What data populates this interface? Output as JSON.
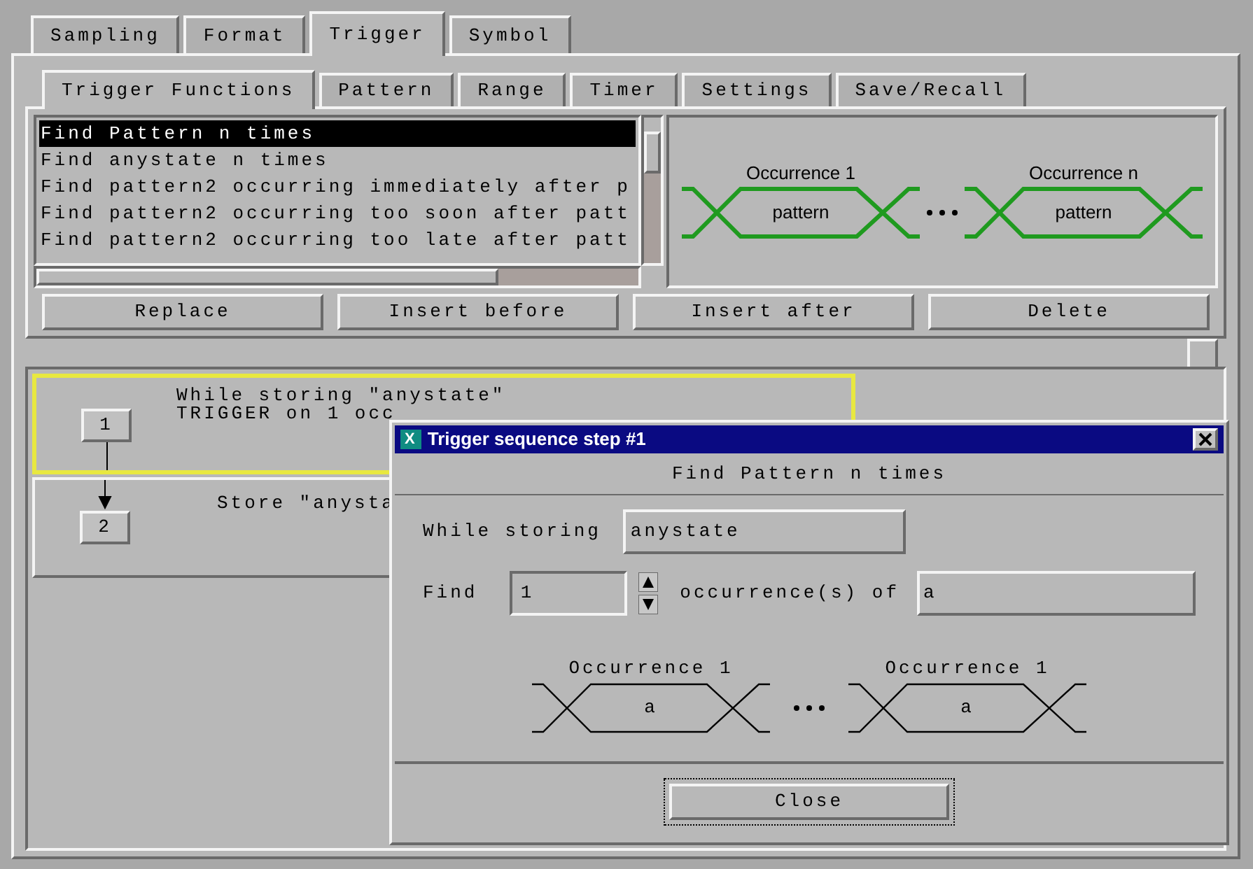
{
  "tabs": [
    {
      "label": "Sampling",
      "selected": false
    },
    {
      "label": "Format",
      "selected": false
    },
    {
      "label": "Trigger",
      "selected": true
    },
    {
      "label": "Symbol",
      "selected": false
    }
  ],
  "subtabs": [
    {
      "label": "Trigger Functions",
      "selected": true
    },
    {
      "label": "Pattern",
      "selected": false
    },
    {
      "label": "Range",
      "selected": false
    },
    {
      "label": "Timer",
      "selected": false
    },
    {
      "label": "Settings",
      "selected": false
    },
    {
      "label": "Save/Recall",
      "selected": false
    }
  ],
  "functions": [
    {
      "label": "Find Pattern n times",
      "selected": true
    },
    {
      "label": "Find anystate n times",
      "selected": false
    },
    {
      "label": "Find pattern2 occurring immediately after p",
      "selected": false
    },
    {
      "label": "Find pattern2 occurring too soon after patt",
      "selected": false
    },
    {
      "label": "Find pattern2 occurring too late after patt",
      "selected": false
    }
  ],
  "preview": {
    "occurrences": [
      {
        "label": "Occurrence 1",
        "value": "pattern"
      },
      {
        "label": "Occurrence n",
        "value": "pattern"
      }
    ]
  },
  "buttons": [
    "Replace",
    "Insert before",
    "Insert after",
    "Delete"
  ],
  "steps": [
    {
      "number": "1",
      "lines": [
        "While storing \"anystate\"",
        "TRIGGER on 1 occ"
      ],
      "selected": true
    },
    {
      "number": "2",
      "lines": [
        "Store \"anysta"
      ],
      "selected": false
    }
  ],
  "dialog": {
    "icon": "X",
    "title": "Trigger sequence step #1",
    "heading": "Find Pattern n times",
    "while_label": "While storing",
    "while_value": "anystate",
    "find_label": "Find",
    "count": "1",
    "of_label": "occurrence(s) of",
    "pattern_value": "a",
    "occurrences": [
      {
        "label": "Occurrence 1",
        "value": "a"
      },
      {
        "label": "Occurrence 1",
        "value": "a"
      }
    ],
    "close": "Close"
  }
}
